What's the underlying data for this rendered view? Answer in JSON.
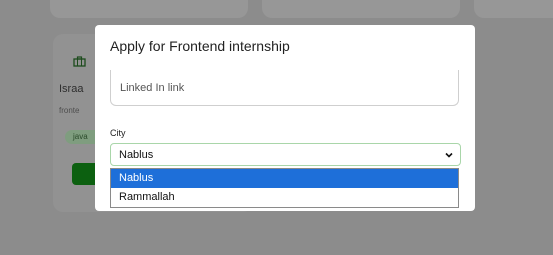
{
  "background": {
    "card": {
      "name": "Israa",
      "subtitle": "fronte",
      "tag": "java"
    }
  },
  "modal": {
    "title": "Apply for Frontend internship",
    "linkedin_placeholder": "Linked In link",
    "city_label": "City",
    "city_selected": "Nablus",
    "city_options": [
      {
        "label": "Nablus",
        "selected": true
      },
      {
        "label": "Rammallah",
        "selected": false
      }
    ]
  },
  "colors": {
    "accent_green": "#0f9a1f",
    "selection_blue": "#1e6fd9"
  },
  "icons": {
    "card_icon": "briefcase-icon",
    "select_icon": "chevron-down-icon"
  }
}
